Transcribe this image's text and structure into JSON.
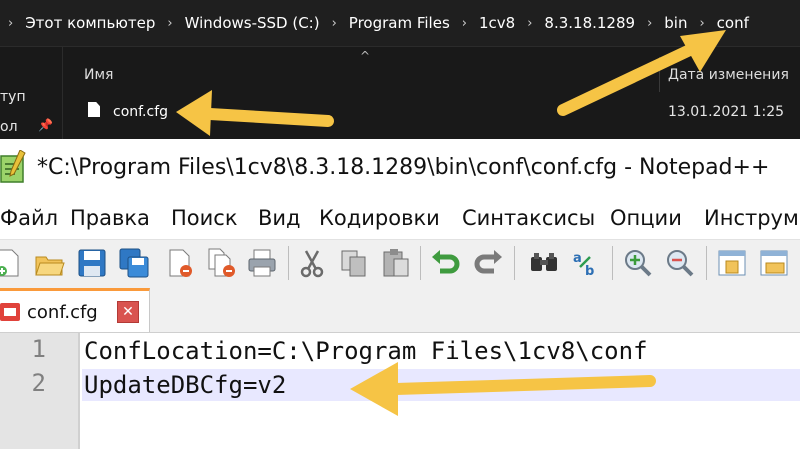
{
  "explorer": {
    "breadcrumb": [
      "Этот компьютер",
      "Windows-SSD (C:)",
      "Program Files",
      "1cv8",
      "8.3.18.1289",
      "bin",
      "conf"
    ],
    "breadcrumb_separator": "›",
    "nav_items": [
      "туп",
      "ол"
    ],
    "columns": {
      "name": "Имя",
      "date": "Дата изменения"
    },
    "file": {
      "name": "conf.cfg",
      "date": "13.01.2021 1:25"
    }
  },
  "notepad": {
    "window_title": "*C:\\Program Files\\1cv8\\8.3.18.1289\\bin\\conf\\conf.cfg - Notepad++",
    "menu": [
      "Файл",
      "Правка",
      "Поиск",
      "Вид",
      "Кодировки",
      "Синтаксисы",
      "Опции",
      "Инструм"
    ],
    "toolbar_icons": [
      "new-file-icon",
      "open-file-icon",
      "save-icon",
      "save-all-icon",
      "close-icon",
      "close-all-icon",
      "print-icon",
      "cut-icon",
      "copy-icon",
      "paste-icon",
      "undo-icon",
      "redo-icon",
      "find-icon",
      "replace-icon",
      "zoom-in-icon",
      "zoom-out-icon",
      "sync-v-icon",
      "sync-h-icon"
    ],
    "tab": {
      "label": "conf.cfg",
      "close": "✕"
    },
    "line_numbers": [
      "1",
      "2"
    ],
    "lines": [
      "ConfLocation=C:\\Program Files\\1cv8\\conf",
      "UpdateDBCfg=v2"
    ]
  },
  "colors": {
    "arrow": "#f6c445",
    "tab_accent": "#fa9a3b",
    "current_line": "#e8e8ff",
    "explorer_bg": "#191919"
  }
}
